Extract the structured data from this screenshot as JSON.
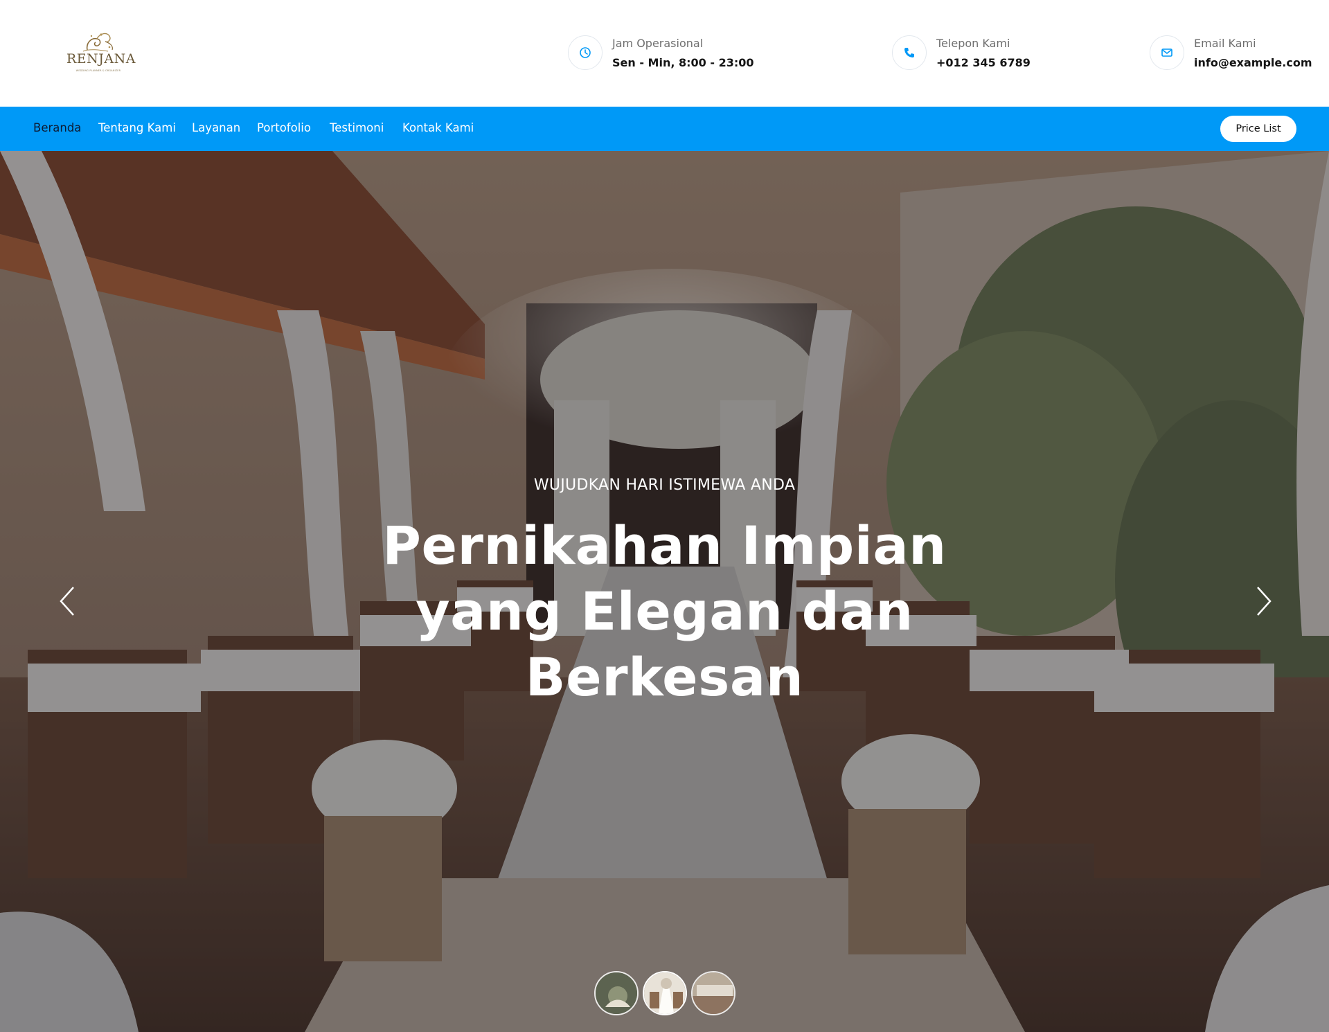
{
  "brand": {
    "logo_text": "RENJANA",
    "logo_tagline": "WEDDING PLANNER & ORGANIZER",
    "accent": "#0099f7"
  },
  "contact": {
    "hours": {
      "label": "Jam Operasional",
      "value": "Sen - Min, 8:00 - 23:00",
      "icon": "clock-icon"
    },
    "phone": {
      "label": "Telepon Kami",
      "value": "+012 345 6789",
      "icon": "phone-icon"
    },
    "email": {
      "label": "Email Kami",
      "value": "info@example.com",
      "icon": "envelope-icon"
    }
  },
  "nav": {
    "items": [
      {
        "label": "Beranda",
        "active": true
      },
      {
        "label": "Tentang Kami",
        "active": false
      },
      {
        "label": "Layanan",
        "active": false
      },
      {
        "label": "Portofolio",
        "active": false
      },
      {
        "label": "Testimoni",
        "active": false
      },
      {
        "label": "Kontak Kami",
        "active": false
      }
    ],
    "price_button": "Price List"
  },
  "hero": {
    "subtitle": "WUJUDKAN HARI ISTIMEWA ANDA",
    "title_lines": [
      "Pernikahan Impian",
      "yang Elegan dan",
      "Berkesan"
    ],
    "prev_icon": "chevron-left-icon",
    "next_icon": "chevron-right-icon",
    "thumbnails": 3,
    "active_thumbnail": 2
  }
}
